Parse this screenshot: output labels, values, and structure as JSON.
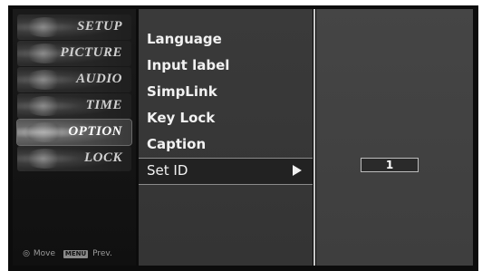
{
  "sidebar": {
    "categories": [
      {
        "label": "SETUP",
        "icon": "setup-icon",
        "active": false
      },
      {
        "label": "PICTURE",
        "icon": "picture-icon",
        "active": false
      },
      {
        "label": "AUDIO",
        "icon": "audio-icon",
        "active": false
      },
      {
        "label": "TIME",
        "icon": "time-icon",
        "active": false
      },
      {
        "label": "OPTION",
        "icon": "option-icon",
        "active": true
      },
      {
        "label": "LOCK",
        "icon": "lock-icon",
        "active": false
      }
    ],
    "hint": {
      "move_label": "Move",
      "menu_key": "MENU",
      "prev_label": "Prev."
    }
  },
  "menu": {
    "items": [
      {
        "label": "Language",
        "selected": false
      },
      {
        "label": "Input label",
        "selected": false
      },
      {
        "label": "SimpLink",
        "selected": false
      },
      {
        "label": "Key Lock",
        "selected": false
      },
      {
        "label": "Caption",
        "selected": false
      },
      {
        "label": "Set ID",
        "selected": true
      }
    ]
  },
  "panel": {
    "set_id_value": "1"
  },
  "colors": {
    "background": "#0c0c0c",
    "menu_bg": "#3a3a3a",
    "selected_bg": "#222222",
    "text": "#f2f2f2",
    "divider": "#c8c8c8"
  }
}
